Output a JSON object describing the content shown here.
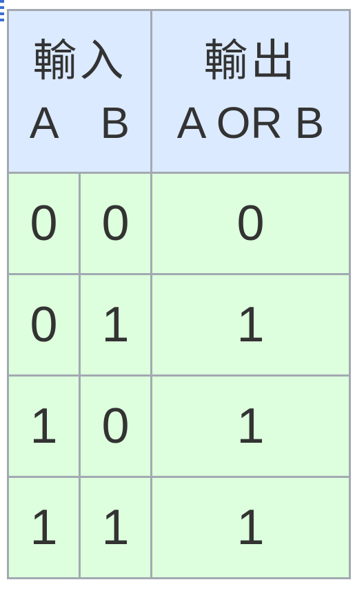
{
  "table": {
    "header": {
      "input_group": "輸入",
      "output_group": "輸出",
      "col_a": "A",
      "col_b": "B",
      "col_out": "A OR B"
    },
    "rows": [
      {
        "a": "0",
        "b": "0",
        "out": "0"
      },
      {
        "a": "0",
        "b": "1",
        "out": "1"
      },
      {
        "a": "1",
        "b": "0",
        "out": "1"
      },
      {
        "a": "1",
        "b": "1",
        "out": "1"
      }
    ]
  },
  "colors": {
    "header_bg": "#dbeaff",
    "body_bg": "#ddffdd",
    "border": "#a2a9b1",
    "text": "#333333"
  }
}
